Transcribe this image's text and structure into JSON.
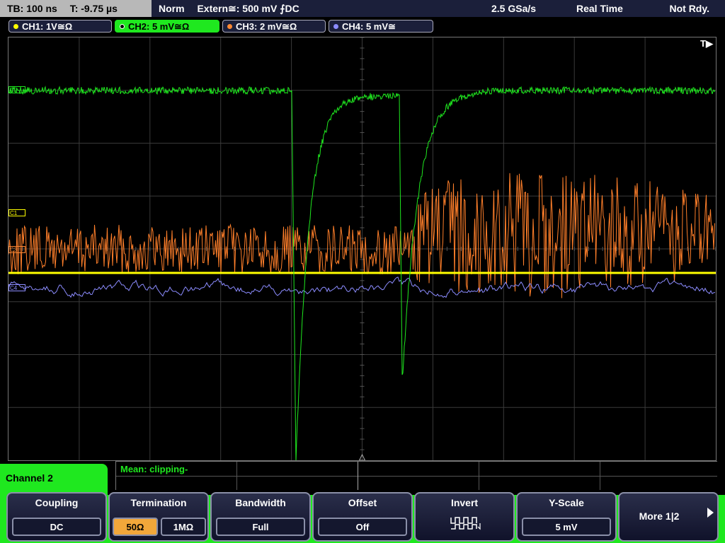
{
  "timebase": {
    "tb": "TB: 100 ns",
    "t": "T: -9.75 µs"
  },
  "trigger": {
    "mode": "Norm",
    "source": "Extern≅: 500 mV ⨍DC"
  },
  "acquisition": {
    "rate": "2.5 GSa/s",
    "mode": "Real Time",
    "status": "Not Rdy."
  },
  "channels": [
    {
      "label": "CH1: 1V≅Ω",
      "color": "#ffff00"
    },
    {
      "label": "CH2: 5 mV≅Ω",
      "color": "#1fe81f"
    },
    {
      "label": "CH3: 2 mV≅Ω",
      "color": "#ff8833"
    },
    {
      "label": "CH4: 5 mV≅",
      "color": "#8c8cff"
    }
  ],
  "trace_markers": {
    "c1": "C1",
    "c2": "C2",
    "c3": "C3",
    "c4": "C4"
  },
  "trigger_marker": "T▶",
  "measurement": "Mean: clipping-",
  "menu_title": "Channel 2",
  "softkeys": {
    "coupling": {
      "title": "Coupling",
      "value": "DC"
    },
    "termination": {
      "title": "Termination",
      "value_a": "50Ω",
      "value_b": "1MΩ"
    },
    "bandwidth": {
      "title": "Bandwidth",
      "value": "Full"
    },
    "offset": {
      "title": "Offset",
      "value": "Off"
    },
    "invert": {
      "title": "Invert"
    },
    "yscale": {
      "title": "Y-Scale",
      "value": "5 mV"
    },
    "more": {
      "label": "More 1|2"
    }
  }
}
